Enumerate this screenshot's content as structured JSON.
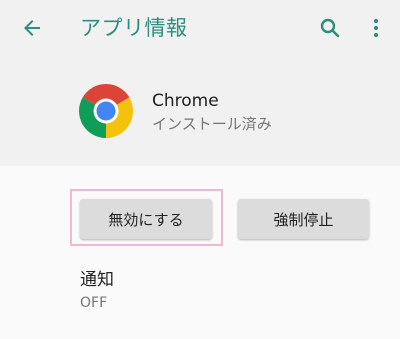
{
  "appbar": {
    "title": "アプリ情報",
    "back_icon": "arrow-left-icon",
    "search_icon": "search-icon",
    "more_icon": "more-vertical-icon",
    "accent_color": "#2a8f80"
  },
  "app": {
    "name": "Chrome",
    "status": "インストール済み",
    "logo_icon": "chrome-logo-icon"
  },
  "actions": {
    "disable_label": "無効にする",
    "force_stop_label": "強制停止"
  },
  "notifications": {
    "title": "通知",
    "value": "OFF"
  }
}
